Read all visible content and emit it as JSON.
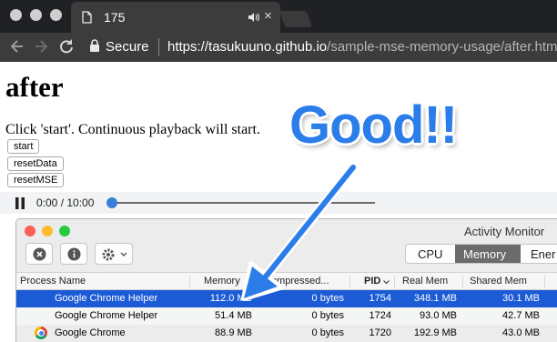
{
  "browser": {
    "tab": {
      "title": "175",
      "page_icon": "document-icon",
      "audio_icon": "speaker-icon",
      "close_icon": "close-icon"
    },
    "toolbar": {
      "secure_label": "Secure",
      "url_host": "https://tasukuuno.github.io",
      "url_path": "/sample-mse-memory-usage/after.html"
    }
  },
  "page": {
    "heading": "after",
    "instruction": "Click 'start'. Continuous playback will start.",
    "buttons": {
      "start": "start",
      "reset_data": "resetData",
      "reset_mse": "resetMSE"
    },
    "player": {
      "time": "0:00 / 10:00",
      "progress": 0.0
    }
  },
  "activity_monitor": {
    "title": "Activity Monitor",
    "segments": {
      "cpu": "CPU",
      "memory": "Memory",
      "energy": "Ener"
    },
    "active_segment": "Memory",
    "columns": {
      "process_name": "Process Name",
      "memory": "Memory",
      "compressed": "Compressed...",
      "pid": "PID",
      "real_mem": "Real Mem",
      "shared_mem": "Shared Mem"
    },
    "rows": [
      {
        "name": "Google Chrome Helper",
        "memory": "112.0 MB",
        "compressed": "0 bytes",
        "pid": "1754",
        "real_mem": "348.1 MB",
        "shared_mem": "30.1 MB",
        "selected": true
      },
      {
        "name": "Google Chrome Helper",
        "memory": "51.4 MB",
        "compressed": "0 bytes",
        "pid": "1724",
        "real_mem": "93.0 MB",
        "shared_mem": "42.7 MB",
        "selected": false
      },
      {
        "name": "Google Chrome",
        "memory": "88.9 MB",
        "compressed": "0 bytes",
        "pid": "1720",
        "real_mem": "192.9 MB",
        "shared_mem": "43.0 MB",
        "selected": false
      }
    ]
  },
  "annotation": {
    "text": "Good!!",
    "color": "#2b7de9"
  },
  "colors": {
    "selection": "#1c5bd6",
    "accent": "#3b7ddb",
    "titlebar": "#202124",
    "toolbar": "#3c3c3c"
  }
}
